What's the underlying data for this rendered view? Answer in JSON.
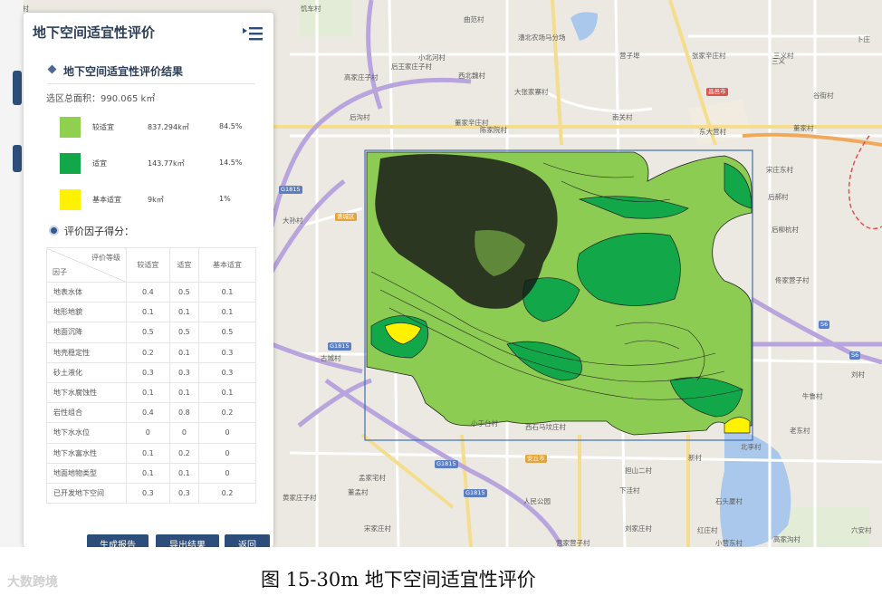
{
  "panel": {
    "title": "地下空间适宜性评价",
    "result_heading": "地下空间适宜性评价结果",
    "area_label": "选区总面积：",
    "area_value": "990.065 k㎡",
    "results": [
      {
        "name": "较适宜",
        "area": "837.294k㎡",
        "percent": "84.5%",
        "color": "#8fd14f"
      },
      {
        "name": "适宜",
        "area": "143.77k㎡",
        "percent": "14.5%",
        "color": "#12a84a"
      },
      {
        "name": "基本适宜",
        "area": "9k㎡",
        "percent": "1%",
        "color": "#fff200"
      }
    ],
    "factor_heading": "评价因子得分：",
    "table": {
      "diag_top": "评价等级",
      "diag_bottom": "因子",
      "columns": [
        "较适宜",
        "适宜",
        "基本适宜"
      ],
      "rows": [
        {
          "factor": "地表水体",
          "values": [
            "0.4",
            "0.5",
            "0.1"
          ]
        },
        {
          "factor": "地形地貌",
          "values": [
            "0.1",
            "0.1",
            "0.1"
          ]
        },
        {
          "factor": "地面沉降",
          "values": [
            "0.5",
            "0.5",
            "0.5"
          ]
        },
        {
          "factor": "地壳稳定性",
          "values": [
            "0.2",
            "0.1",
            "0.3"
          ]
        },
        {
          "factor": "砂土液化",
          "values": [
            "0.3",
            "0.3",
            "0.3"
          ]
        },
        {
          "factor": "地下水腐蚀性",
          "values": [
            "0.1",
            "0.1",
            "0.1"
          ]
        },
        {
          "factor": "岩性组合",
          "values": [
            "0.4",
            "0.8",
            "0.2"
          ]
        },
        {
          "factor": "地下水水位",
          "values": [
            "0",
            "0",
            "0"
          ]
        },
        {
          "factor": "地下水富水性",
          "values": [
            "0.1",
            "0.2",
            "0"
          ]
        },
        {
          "factor": "地面地物类型",
          "values": [
            "0.1",
            "0.1",
            "0"
          ]
        },
        {
          "factor": "已开发地下空间",
          "values": [
            "0.3",
            "0.3",
            "0.2"
          ]
        }
      ]
    },
    "buttons": {
      "report": "生成报告",
      "export": "导出结果",
      "back": "返回"
    }
  },
  "map": {
    "places": [
      "兴旺官村",
      "饥车村",
      "曲范村",
      "漕北农场马分场",
      "三义村",
      "卜庄",
      "小北河村",
      "营子埠",
      "张家辛庄村",
      "后王家庄子村",
      "西北魏村",
      "高家庄子村",
      "大张家寨村",
      "后沟村",
      "董家辛庄村",
      "陈家院村",
      "南关村",
      "谷街村",
      "董家村",
      "东大营村",
      "宋庄东村",
      "后郝村",
      "后柳杭村",
      "佟家营子村",
      "古城村",
      "大孙村",
      "牛鲁村",
      "刘村",
      "老东村",
      "西石马坟庄村",
      "小于台村",
      "北李村",
      "新村",
      "担山二村",
      "孟家宅村",
      "黄家庄子村",
      "董孟村",
      "下洼村",
      "人民公园",
      "宋家庄村",
      "石头厦村",
      "刘家庄村",
      "营家营子村",
      "小营东村",
      "高家沟村",
      "红庄村",
      "三义",
      "六安村"
    ],
    "road_labels": [
      "G1815",
      "G1815",
      "G1815",
      "G1815",
      "S6",
      "S6",
      "谯城区",
      "安丘市",
      "昌邑市"
    ]
  },
  "caption": {
    "watermark": "大数跨境",
    "figure": "图   15-30m 地下空间适宜性评价"
  },
  "colors": {
    "panel_title": "#2d3f59",
    "button": "#2d4e7a",
    "suitable_more": "#8fd14f",
    "suitable": "#12a84a",
    "basic": "#fff200"
  }
}
